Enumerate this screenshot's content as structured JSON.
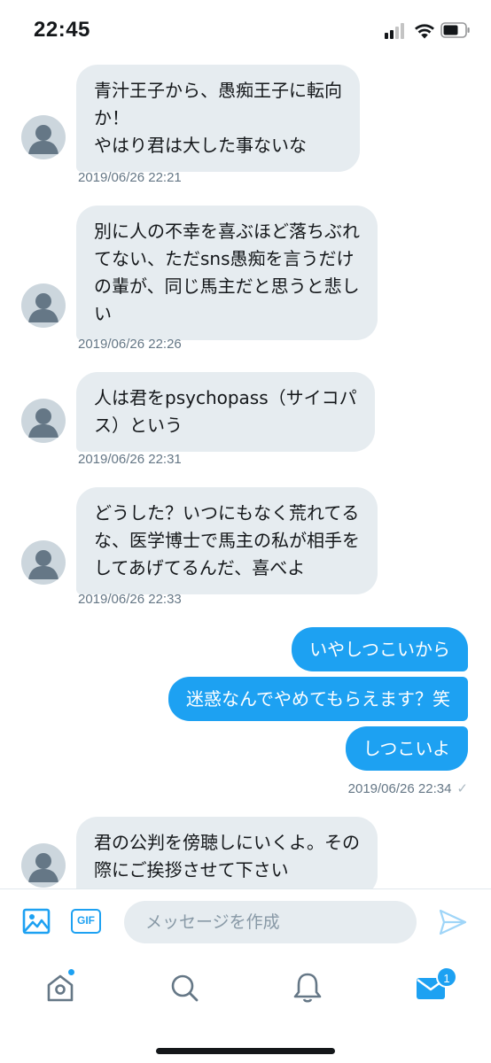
{
  "status_bar": {
    "time": "22:45"
  },
  "messages_in": [
    {
      "text": "青汁王子から、愚痴王子に転向\nか！\nやはり君は大した事ないな",
      "timestamp": "2019/06/26 22:21"
    },
    {
      "text": "別に人の不幸を喜ぶほど落ちぶれ\nてない、ただsns愚痴を言うだけ\nの輩が、同じ馬主だと思うと悲し\nい",
      "timestamp": "2019/06/26 22:26"
    },
    {
      "text": "人は君をpsychopass（サイコパ\nス）という",
      "timestamp": "2019/06/26 22:31"
    },
    {
      "text": "どうした？いつにもなく荒れてる\nな、医学博士で馬主の私が相手を\nしてあげてるんだ、喜べよ",
      "timestamp": "2019/06/26 22:33"
    },
    {
      "text": "君の公判を傍聴しにいくよ。その\n際にご挨拶させて下さい",
      "timestamp": ""
    }
  ],
  "messages_out": {
    "items": [
      "いやしつこいから",
      "迷惑なんでやめてもらえます？笑",
      "しつこいよ"
    ],
    "timestamp": "2019/06/26 22:34",
    "status_mark": "✓"
  },
  "composer": {
    "gif_label": "GIF",
    "placeholder": "メッセージを作成"
  },
  "tabbar": {
    "tabs": [
      "home-icon",
      "search-icon",
      "notifications-icon",
      "messages-icon"
    ],
    "messages_badge": "1",
    "home_has_dot": true
  },
  "colors": {
    "accent": "#1da1f2",
    "incoming_bubble": "#e6ecf0",
    "timestamp": "#657786"
  }
}
